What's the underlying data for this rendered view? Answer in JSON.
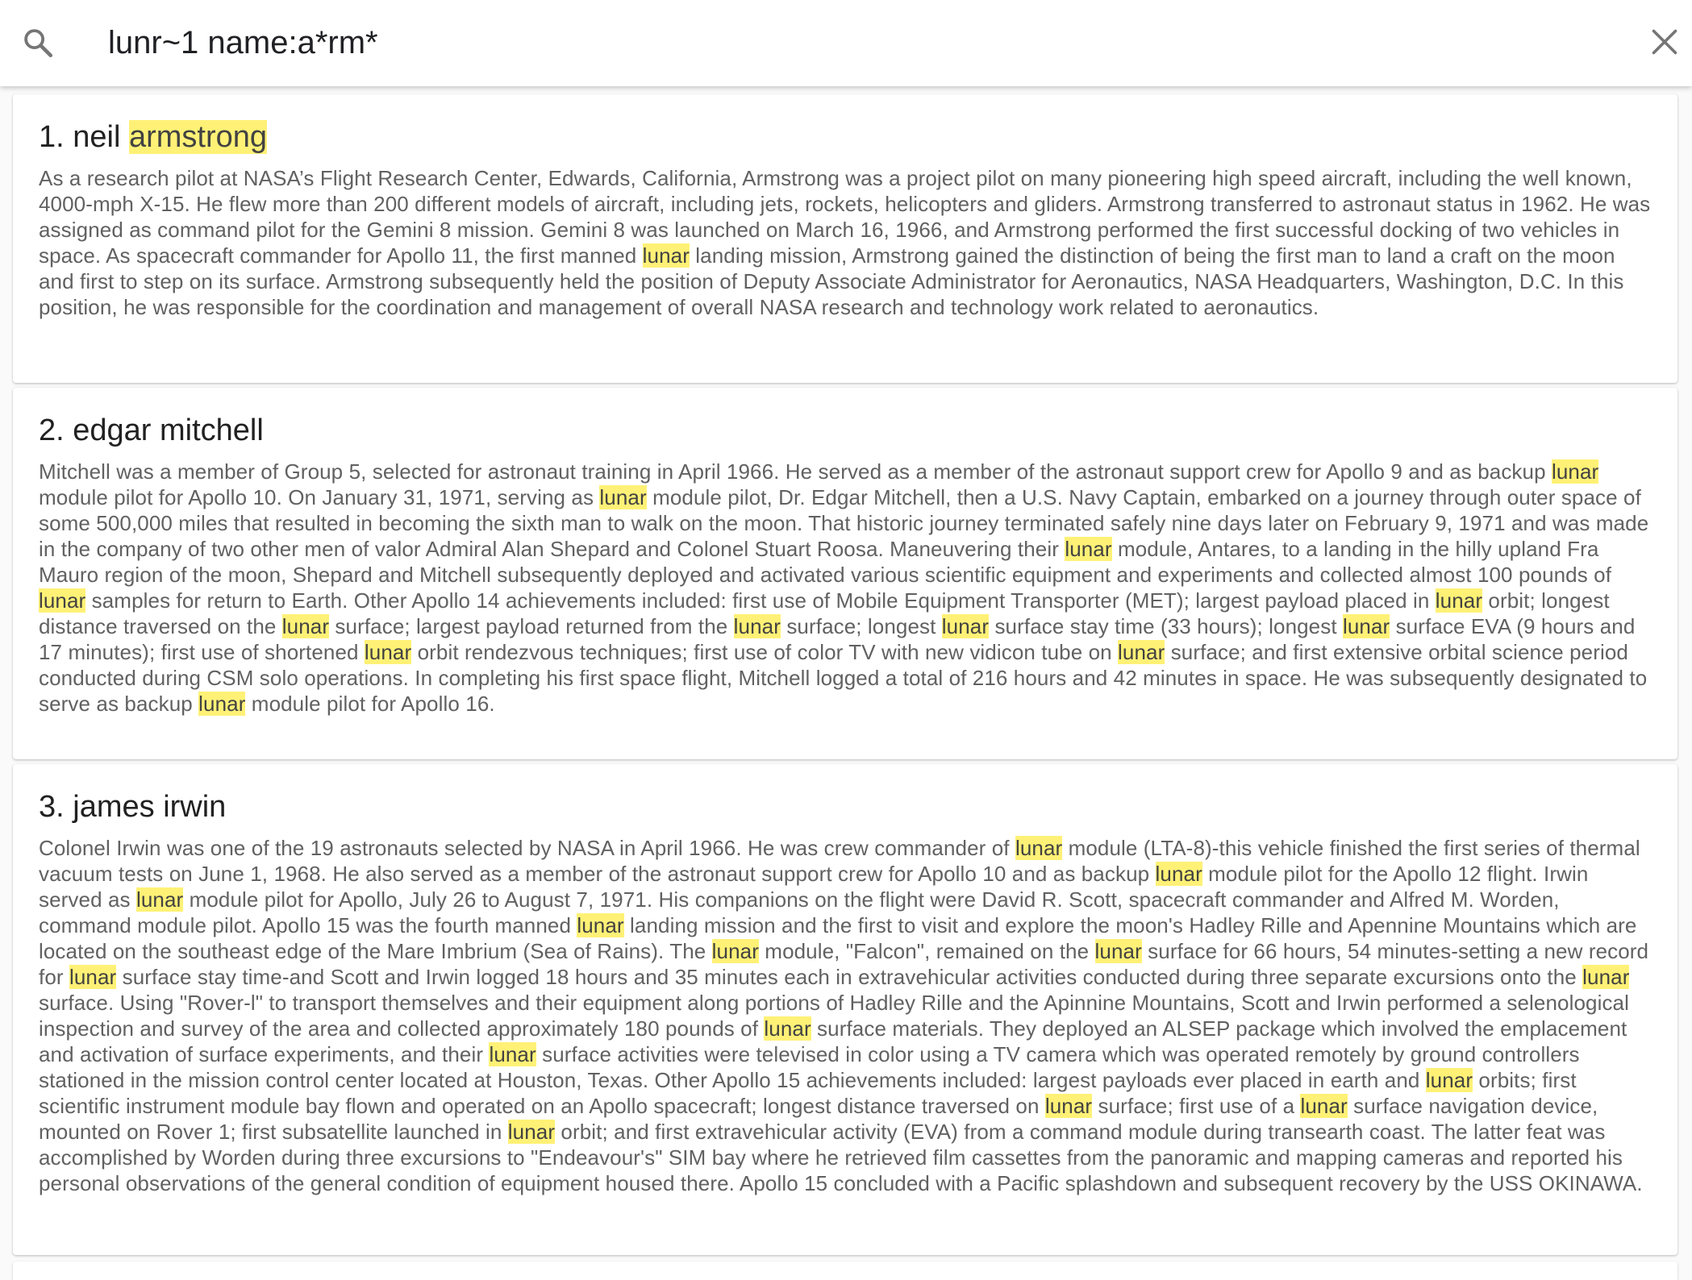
{
  "search": {
    "query": "lunr~1 name:a*rm*",
    "icon": "search-icon",
    "clear_icon": "close-icon"
  },
  "colors": {
    "highlight": "#fff176",
    "caret": "#1a73e8",
    "body_text": "#616161",
    "title_text": "#212121"
  },
  "results": [
    {
      "number": "1.",
      "name_parts": [
        {
          "text": "neil ",
          "hl": false
        },
        {
          "text": "armstrong",
          "hl": true
        }
      ],
      "body": [
        {
          "text": "As a research pilot at NASA’s Flight Research Center, Edwards, California, Armstrong was a project pilot on many pioneering high speed aircraft, including the well known, 4000-mph X-15. He flew more than 200 different models of aircraft, including jets, rockets, helicopters and gliders. Armstrong transferred to astronaut status in 1962. He was assigned as command pilot for the Gemini 8 mission. Gemini 8 was launched on March 16, 1966, and Armstrong performed the first successful docking of two vehicles in space. As spacecraft commander for Apollo 11, the first manned ",
          "hl": false
        },
        {
          "text": "lunar",
          "hl": true
        },
        {
          "text": " landing mission, Armstrong gained the distinction of being the first man to land a craft on the moon and first to step on its surface. Armstrong subsequently held the position of Deputy Associate Administrator for Aeronautics, NASA Headquarters, Washington, D.C. In this position, he was responsible for the coordination and management of overall NASA research and technology work related to aeronautics.",
          "hl": false
        }
      ]
    },
    {
      "number": "2.",
      "name_parts": [
        {
          "text": "edgar mitchell",
          "hl": false
        }
      ],
      "body": [
        {
          "text": "Mitchell was a member of Group 5, selected for astronaut training in April 1966. He served as a member of the astronaut support crew for Apollo 9 and as backup ",
          "hl": false
        },
        {
          "text": "lunar",
          "hl": true
        },
        {
          "text": " module pilot for Apollo 10. On January 31, 1971, serving as ",
          "hl": false
        },
        {
          "text": "lunar",
          "hl": true
        },
        {
          "text": " module pilot, Dr. Edgar Mitchell, then a U.S. Navy Captain, embarked on a journey through outer space of some 500,000 miles that resulted in becoming the sixth man to walk on the moon. That historic journey terminated safely nine days later on February 9, 1971 and was made in the company of two other men of valor Admiral Alan Shepard and Colonel Stuart Roosa. Maneuvering their ",
          "hl": false
        },
        {
          "text": "lunar",
          "hl": true
        },
        {
          "text": " module, Antares, to a landing in the hilly upland Fra Mauro region of the moon, Shepard and Mitchell subsequently deployed and activated various scientific equipment and experiments and collected almost 100 pounds of ",
          "hl": false
        },
        {
          "text": "lunar",
          "hl": true
        },
        {
          "text": " samples for return to Earth. Other Apollo 14 achievements included: first use of Mobile Equipment Transporter (MET); largest payload placed in ",
          "hl": false
        },
        {
          "text": "lunar",
          "hl": true
        },
        {
          "text": " orbit; longest distance traversed on the ",
          "hl": false
        },
        {
          "text": "lunar",
          "hl": true
        },
        {
          "text": " surface; largest payload returned from the ",
          "hl": false
        },
        {
          "text": "lunar",
          "hl": true
        },
        {
          "text": " surface; longest ",
          "hl": false
        },
        {
          "text": "lunar",
          "hl": true
        },
        {
          "text": " surface stay time (33 hours); longest ",
          "hl": false
        },
        {
          "text": "lunar",
          "hl": true
        },
        {
          "text": " surface EVA (9 hours and 17 minutes); first use of shortened ",
          "hl": false
        },
        {
          "text": "lunar",
          "hl": true
        },
        {
          "text": " orbit rendezvous techniques; first use of color TV with new vidicon tube on ",
          "hl": false
        },
        {
          "text": "lunar",
          "hl": true
        },
        {
          "text": " surface; and first extensive orbital science period conducted during CSM solo operations. In completing his first space flight, Mitchell logged a total of 216 hours and 42 minutes in space. He was subsequently designated to serve as backup ",
          "hl": false
        },
        {
          "text": "lunar",
          "hl": true
        },
        {
          "text": " module pilot for Apollo 16.",
          "hl": false
        }
      ]
    },
    {
      "number": "3.",
      "name_parts": [
        {
          "text": "james irwin",
          "hl": false
        }
      ],
      "body": [
        {
          "text": "Colonel Irwin was one of the 19 astronauts selected by NASA in April 1966. He was crew commander of ",
          "hl": false
        },
        {
          "text": "lunar",
          "hl": true
        },
        {
          "text": " module (LTA-8)-this vehicle finished the first series of thermal vacuum tests on June 1, 1968. He also served as a member of the astronaut support crew for Apollo 10 and as backup ",
          "hl": false
        },
        {
          "text": "lunar",
          "hl": true
        },
        {
          "text": " module pilot for the Apollo 12 flight. Irwin served as ",
          "hl": false
        },
        {
          "text": "lunar",
          "hl": true
        },
        {
          "text": " module pilot for Apollo, July 26 to August 7, 1971. His companions on the flight were David R. Scott, spacecraft commander and Alfred M. Worden, command module pilot. Apollo 15 was the fourth manned ",
          "hl": false
        },
        {
          "text": "lunar",
          "hl": true
        },
        {
          "text": " landing mission and the first to visit and explore the moon's Hadley Rille and Apennine Mountains which are located on the southeast edge of the Mare Imbrium (Sea of Rains). The ",
          "hl": false
        },
        {
          "text": "lunar",
          "hl": true
        },
        {
          "text": " module, \"Falcon\", remained on the ",
          "hl": false
        },
        {
          "text": "lunar",
          "hl": true
        },
        {
          "text": " surface for 66 hours, 54 minutes-setting a new record for ",
          "hl": false
        },
        {
          "text": "lunar",
          "hl": true
        },
        {
          "text": " surface stay time-and Scott and Irwin logged 18 hours and 35 minutes each in extravehicular activities conducted during three separate excursions onto the ",
          "hl": false
        },
        {
          "text": "lunar",
          "hl": true
        },
        {
          "text": " surface. Using \"Rover-l\" to transport themselves and their equipment along portions of Hadley Rille and the Apinnine Mountains, Scott and Irwin performed a selenological inspection and survey of the area and collected approximately 180 pounds of ",
          "hl": false
        },
        {
          "text": "lunar",
          "hl": true
        },
        {
          "text": " surface materials. They deployed an ALSEP package which involved the emplacement and activation of surface experiments, and their ",
          "hl": false
        },
        {
          "text": "lunar",
          "hl": true
        },
        {
          "text": " surface activities were televised in color using a TV camera which was operated remotely by ground controllers stationed in the mission control center located at Houston, Texas. Other Apollo 15 achievements included: largest payloads ever placed in earth and ",
          "hl": false
        },
        {
          "text": "lunar",
          "hl": true
        },
        {
          "text": " orbits; first scientific instrument module bay flown and operated on an Apollo spacecraft; longest distance traversed on ",
          "hl": false
        },
        {
          "text": "lunar",
          "hl": true
        },
        {
          "text": " surface; first use of a ",
          "hl": false
        },
        {
          "text": "lunar",
          "hl": true
        },
        {
          "text": " surface navigation device, mounted on Rover 1; first subsatellite launched in ",
          "hl": false
        },
        {
          "text": "lunar",
          "hl": true
        },
        {
          "text": " orbit; and first extravehicular activity (EVA) from a command module during transearth coast. The latter feat was accomplished by Worden during three excursions to \"Endeavour's\" SIM bay where he retrieved film cassettes from the panoramic and mapping cameras and reported his personal observations of the general condition of equipment housed there. Apollo 15 concluded with a Pacific splashdown and subsequent recovery by the USS OKINAWA.",
          "hl": false
        }
      ]
    }
  ]
}
